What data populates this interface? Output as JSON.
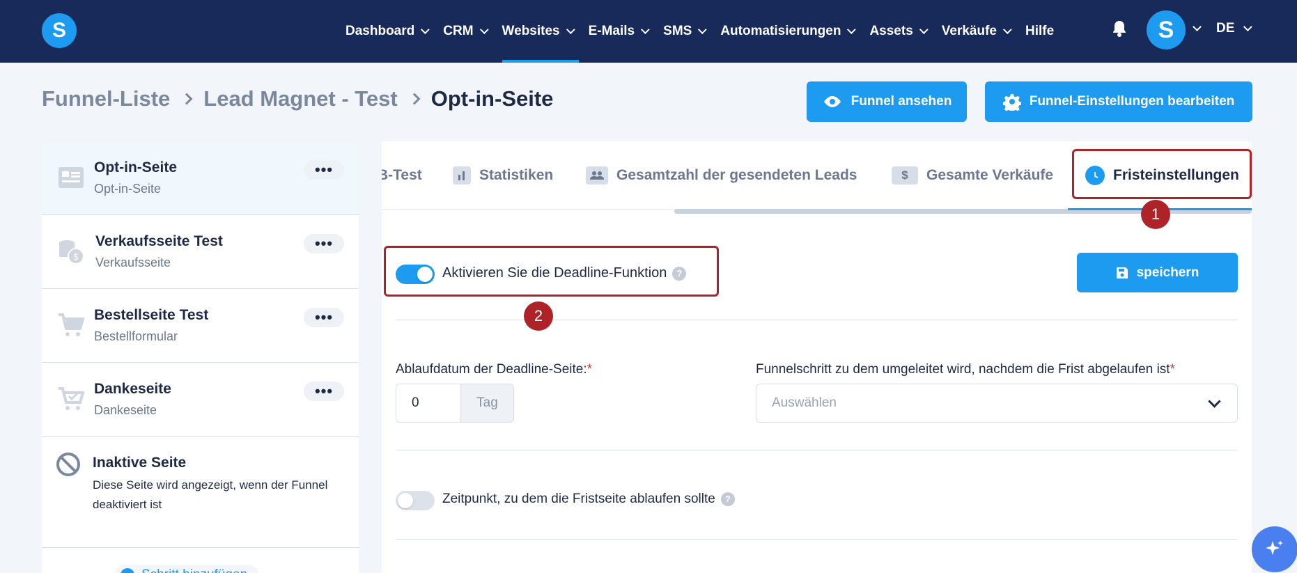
{
  "colors": {
    "nav_bg": "#172a5a",
    "accent": "#1d9bf0",
    "annotation": "#ad2328",
    "required": "#e0342e"
  },
  "header": {
    "logo_letter": "S",
    "nav": [
      {
        "label": "Dashboard",
        "has_dropdown": true,
        "active": false
      },
      {
        "label": "CRM",
        "has_dropdown": true,
        "active": false
      },
      {
        "label": "Websites",
        "has_dropdown": true,
        "active": true
      },
      {
        "label": "E-Mails",
        "has_dropdown": true,
        "active": false
      },
      {
        "label": "SMS",
        "has_dropdown": true,
        "active": false
      },
      {
        "label": "Automatisierungen",
        "has_dropdown": true,
        "active": false
      },
      {
        "label": "Assets",
        "has_dropdown": true,
        "active": false
      },
      {
        "label": "Verkäufe",
        "has_dropdown": true,
        "active": false
      },
      {
        "label": "Hilfe",
        "has_dropdown": false,
        "active": false
      }
    ],
    "avatar_letter": "S",
    "language": "DE"
  },
  "breadcrumb": {
    "items": [
      "Funnel-Liste",
      "Lead Magnet - Test",
      "Opt-in-Seite"
    ]
  },
  "actions": {
    "view_funnel": "Funnel ansehen",
    "edit_settings": "Funnel-Einstellungen bearbeiten"
  },
  "sidebar": {
    "items": [
      {
        "title": "Opt-in-Seite",
        "subtitle": "Opt-in-Seite",
        "icon": "form-page-icon",
        "active": true
      },
      {
        "title": "Verkaufsseite Test",
        "subtitle": "Verkaufsseite",
        "icon": "coins-icon",
        "active": false
      },
      {
        "title": "Bestellseite Test",
        "subtitle": "Bestellformular",
        "icon": "cart-icon",
        "active": false
      },
      {
        "title": "Dankeseite",
        "subtitle": "Dankeseite",
        "icon": "cart-check-icon",
        "active": false
      }
    ],
    "more_label": "•••",
    "inactive": {
      "title": "Inaktive Seite",
      "description": "Diese Seite wird angezeigt, wenn der Funnel deaktiviert ist"
    },
    "add_step_label": "Schritt hinzufügen"
  },
  "tabs": {
    "items": [
      {
        "label": "B-Test",
        "icon": "split-test-icon"
      },
      {
        "label": "Statistiken",
        "icon": "bar-chart-icon"
      },
      {
        "label": "Gesamtzahl der gesendeten Leads",
        "icon": "users-icon"
      },
      {
        "label": "Gesamte Verkäufe",
        "icon": "dollar-icon"
      },
      {
        "label": "Fristeinstellungen",
        "icon": "clock-icon",
        "active": true
      }
    ]
  },
  "deadline": {
    "enable_label": "Aktivieren Sie die Deadline-Funktion",
    "enabled": true,
    "save_label": "speichern",
    "expiry_label": "Ablaufdatum der Deadline-Seite:",
    "expiry_value": "0",
    "expiry_unit": "Tag",
    "redirect_label": "Funnelschritt zu dem umgeleitet wird, nachdem die Frist abgelaufen ist",
    "redirect_placeholder": "Auswählen",
    "time_label": "Zeitpunkt, zu dem die Fristseite ablaufen sollte",
    "time_enabled": false,
    "required_mark": "*",
    "help_mark": "?"
  },
  "annotations": {
    "marker_1": "1",
    "marker_2": "2"
  }
}
